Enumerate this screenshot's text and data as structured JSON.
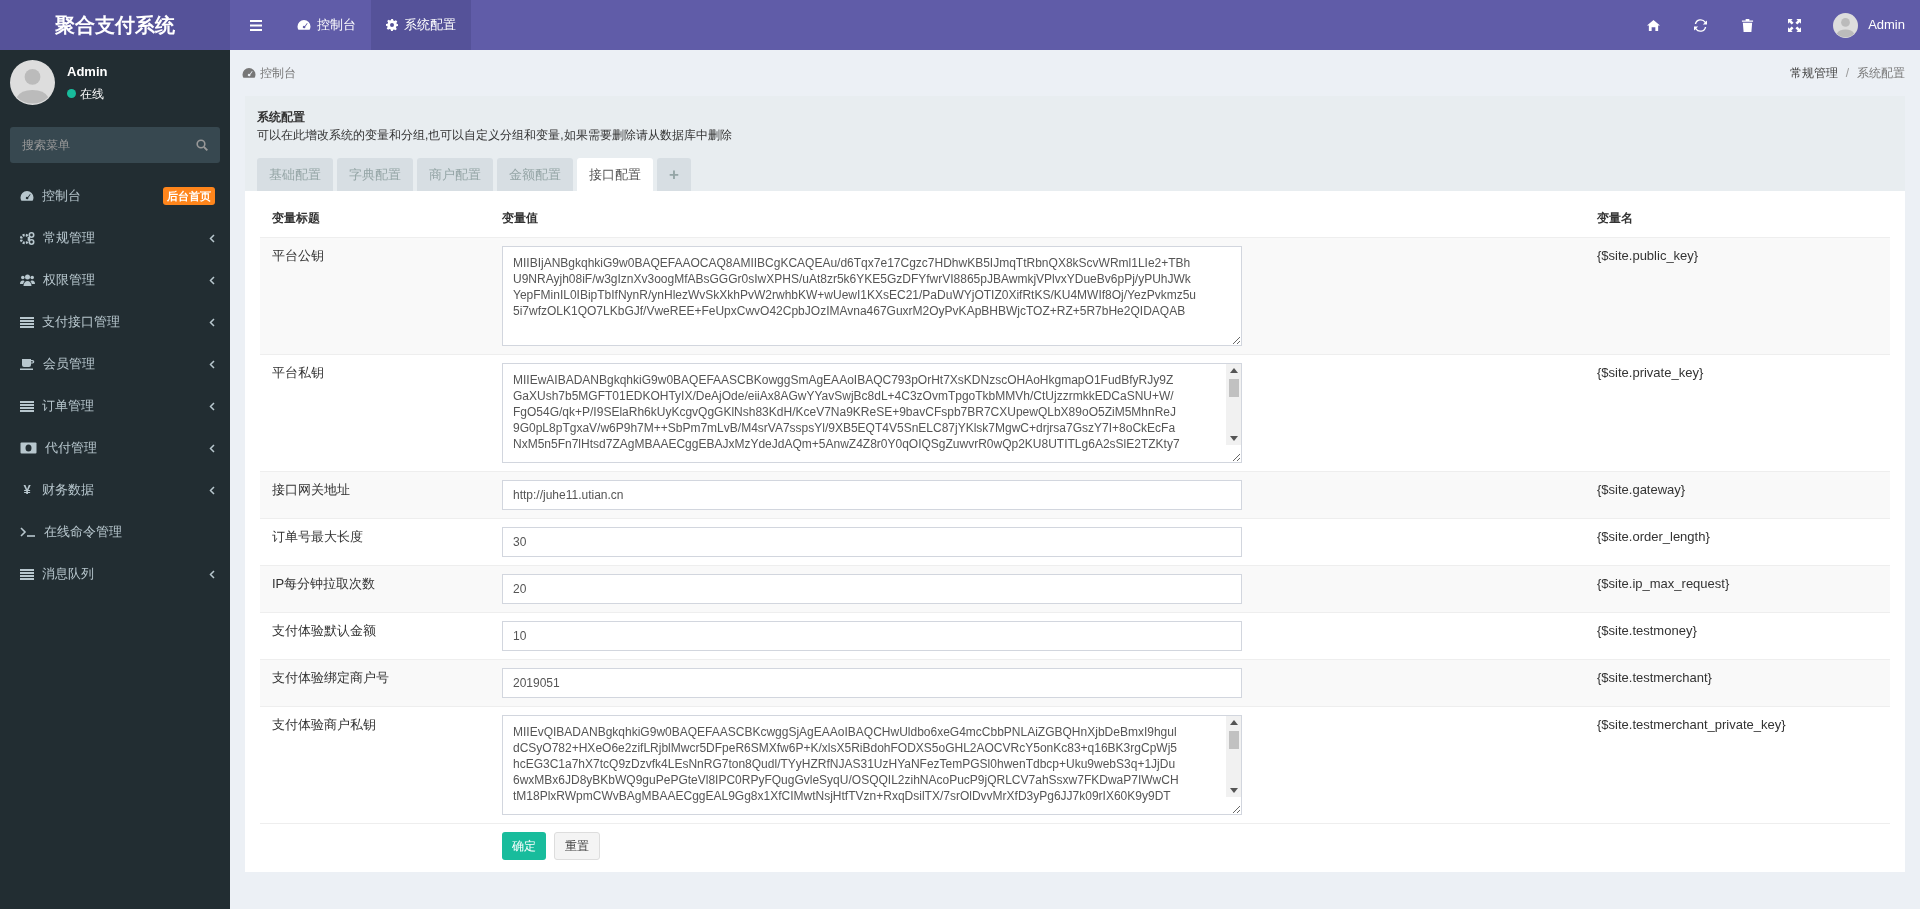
{
  "brand": "聚合支付系统",
  "top_nav": [
    {
      "label": "控制台",
      "selected": false
    },
    {
      "label": "系统配置",
      "selected": true
    }
  ],
  "top_right": {
    "user": "Admin"
  },
  "sidebar": {
    "user": {
      "name": "Admin",
      "status": "在线"
    },
    "search": {
      "placeholder": "搜索菜单"
    },
    "items": [
      {
        "label": "控制台",
        "badge": "后台首页",
        "expandable": false
      },
      {
        "label": "常规管理",
        "expandable": true
      },
      {
        "label": "权限管理",
        "expandable": true
      },
      {
        "label": "支付接口管理",
        "expandable": true
      },
      {
        "label": "会员管理",
        "expandable": true
      },
      {
        "label": "订单管理",
        "expandable": true
      },
      {
        "label": "代付管理",
        "expandable": true
      },
      {
        "glyph": "¥",
        "label": "财务数据",
        "expandable": true
      },
      {
        "label": "在线命令管理",
        "expandable": false
      },
      {
        "label": "消息队列",
        "expandable": true
      }
    ]
  },
  "breadcrumb": {
    "title": "控制台",
    "trail": [
      "常规管理",
      "系统配置"
    ],
    "separator": "/"
  },
  "panel": {
    "title": "系统配置",
    "description": "可以在此增改系统的变量和分组,也可以自定义分组和变量,如果需要删除请从数据库中删除",
    "tabs": [
      {
        "label": "基础配置",
        "selected": false
      },
      {
        "label": "字典配置",
        "selected": false
      },
      {
        "label": "商户配置",
        "selected": false
      },
      {
        "label": "金额配置",
        "selected": false
      },
      {
        "label": "接口配置",
        "selected": true
      },
      {
        "label": "+",
        "selected": false
      }
    ],
    "table": {
      "columns": [
        "变量标题",
        "变量值",
        "变量名"
      ],
      "rows": [
        {
          "title": "平台公钥",
          "kind": "textarea",
          "scrollable": false,
          "value": "MIIBIjANBgkqhkiG9w0BAQEFAAOCAQ8AMIIBCgKCAQEAu/d6Tqx7e17Cgzc7HDhwKB5IJmqTtRbnQX8kScvWRml1LIe2+TBh\nU9NRAyjh08iF/w3gIznXv3oogMfABsGGGr0sIwXPHS/uAt8zr5k6YKE5GzDFYfwrVI8865pJBAwmkjVPlvxYDueBv6pPj/yPUhJWk\nYepFMinIL0IBipTbIfNynR/ynHlezWvSkXkhPvW2rwhbKW+wUewI1KXsEC21/PaDuWYjOTIZ0XifRtKS/KU4MWIf8Oj/YezPvkmz5u\n5i7wfzOLK1QO7LKbGJf/VweREE+FeUpxCwvO42CpbJOzIMAvna467GuxrM2OyPvKApBHBWjcTOZ+RZ+5R7bHe2QIDAQAB",
          "name": "{$site.public_key}"
        },
        {
          "title": "平台私钥",
          "kind": "textarea",
          "scrollable": true,
          "value": "MIIEwAIBADANBgkqhkiG9w0BAQEFAASCBKowggSmAgEAAoIBAQC793pOrHt7XsKDNzscOHAoHkgmapO1FudBfyRJy9Z\nGaXUsh7b5MGFT01EDKOHTyIX/DeAjOde/eiiAx8AGwYYavSwjBc8dL+4C3zOvmTpgoTkbMMVh/CtUjzzrmkkEDCaSNU+W/\nFgO54G/qk+P/I9SElaRh6kUyKcgvQgGKlNsh83KdH/KceV7Na9KReSE+9bavCFspb7BR7CXUpewQLbX89oO5ZiM5MhnReJ\n9G0pL8pTgxaV/w6P9h7M++SbPm7mLvB/M4srVA7sspsYl/9XB5EQT4V5SnELC87jYKlsk7MgwC+drjrsa7GszY7I+8oCkEcFa\nNxM5n5Fn7lHtsd7ZAgMBAAECggEBAJxMzYdeJdAQm+5AnwZ4Z8r0Y0qOIQSgZuwvrR0wQp2KU8UTITLg6A2sSlE2TZKty7",
          "name": "{$site.private_key}"
        },
        {
          "title": "接口网关地址",
          "kind": "input",
          "value": "http://juhe11.utian.cn",
          "name": "{$site.gateway}"
        },
        {
          "title": "订单号最大长度",
          "kind": "input",
          "value": "30",
          "name": "{$site.order_length}"
        },
        {
          "title": "IP每分钟拉取次数",
          "kind": "input",
          "value": "20",
          "name": "{$site.ip_max_request}"
        },
        {
          "title": "支付体验默认金额",
          "kind": "input",
          "value": "10",
          "name": "{$site.testmoney}"
        },
        {
          "title": "支付体验绑定商户号",
          "kind": "input",
          "value": "2019051",
          "name": "{$site.testmerchant}"
        },
        {
          "title": "支付体验商户私钥",
          "kind": "textarea",
          "scrollable": true,
          "value": "MIIEvQIBADANBgkqhkiG9w0BAQEFAASCBKcwggSjAgEAAoIBAQCHwUldbo6xeG4mcCbbPNLAiZGBQHnXjbDeBmxI9hgul\ndCSyO782+HXeO6e2zifLRjblMwcr5DFpeR6SMXfw6P+K/xlsX5RiBdohFODXS5oGHL2AOCVRcY5onKc83+q16BK3rgCpWj5\nhcEG3C1a7hX7tcQ9zDzvfk4LEsNnRG7ton8Qudl/TYyHZRfNJAS31UzHYaNFezTemPGSl0hwenTdbcp+Uku9webS3q+1JjDu\n6wxMBx6JD8yBKbWQ9guPePGteVl8IPC0RPyFQugGvleSyqU/OSQQIL2zihNAcoPucP9jQRLCV7ahSsxw7FKDwaP7IWwCH\ntM18PlxRWpmCWvBAgMBAAECggEAL9Gg8x1XfCIMwtNsjHtfTVzn+RxqDsilTX/7srOlDvvMrXfD3yPg6JJ7k09rIX60K9y9DT",
          "name": "{$site.testmerchant_private_key}"
        }
      ]
    },
    "buttons": [
      {
        "kind": "primary",
        "label": "确定"
      },
      {
        "kind": "default",
        "label": "重置"
      }
    ]
  }
}
